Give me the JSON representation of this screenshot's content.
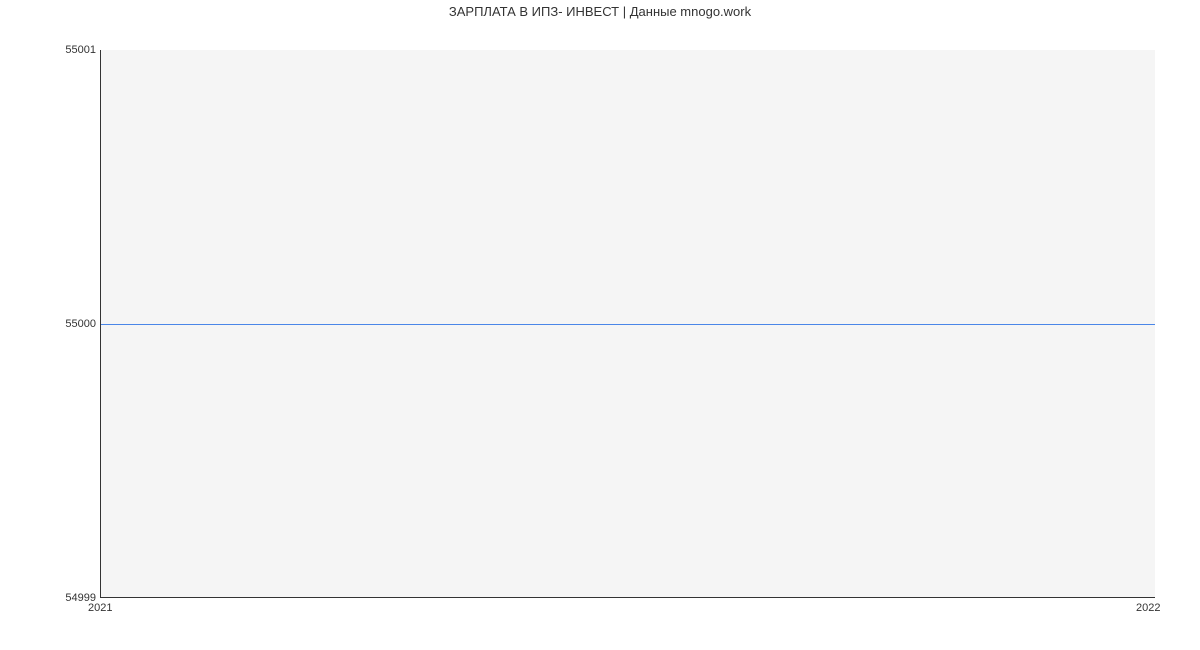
{
  "chart_data": {
    "type": "line",
    "title": "ЗАРПЛАТА В ИПЗ- ИНВЕСТ | Данные mnogo.work",
    "xlabel": "",
    "ylabel": "",
    "x": [
      2021,
      2022
    ],
    "y": [
      55000,
      55000
    ],
    "xlim": [
      2021,
      2022
    ],
    "ylim": [
      54999,
      55001
    ],
    "x_ticks": [
      "2021",
      "2022"
    ],
    "y_ticks": [
      "54999",
      "55000",
      "55001"
    ],
    "line_color": "#4a86e8",
    "background": "#f5f5f5"
  }
}
